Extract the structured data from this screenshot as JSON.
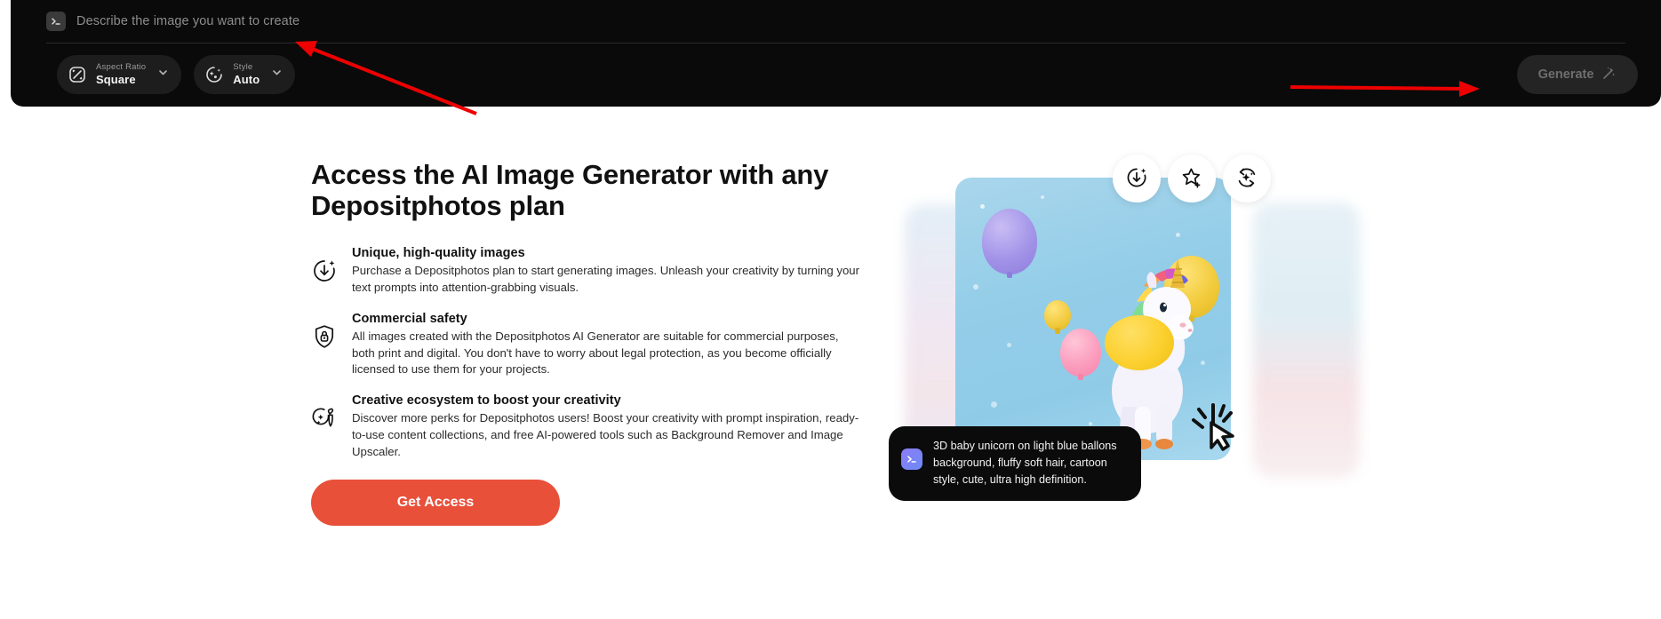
{
  "generator": {
    "prompt_icon": "terminal-icon",
    "prompt_placeholder": "Describe the image you want to create",
    "prompt_value": "",
    "controls": [
      {
        "icon": "aspect-ratio-icon",
        "label": "Aspect Ratio",
        "value": "Square"
      },
      {
        "icon": "style-sparkle-icon",
        "label": "Style",
        "value": "Auto"
      }
    ],
    "generate_label": "Generate",
    "generate_icon": "magic-wand-icon"
  },
  "promo": {
    "headline": "Access the AI Image Generator with any Depositphotos plan",
    "features": [
      {
        "icon": "download-sparkle-icon",
        "title": "Unique, high-quality images",
        "desc": "Purchase a Depositphotos plan to start generating images. Unleash your creativity by turning your text prompts into attention-grabbing visuals."
      },
      {
        "icon": "shield-lock-icon",
        "title": "Commercial safety",
        "desc": "All images created with the Depositphotos AI Generator are suitable for commercial purposes, both print and digital. You don't have to worry about legal protection, as you become officially licensed to use them for your projects."
      },
      {
        "icon": "magic-wand-sparkle-icon",
        "title": "Creative ecosystem to boost your creativity",
        "desc": "Discover more perks for Depositphotos users! Boost your creativity with prompt inspiration, ready-to-use content collections, and free AI-powered tools such as Background Remover and Image Upscaler."
      }
    ],
    "cta_label": "Get Access"
  },
  "showcase": {
    "image_alt": "3D baby unicorn with balloons",
    "actions": [
      {
        "icon": "download-sparkle-icon",
        "name": "download-button"
      },
      {
        "icon": "star-plus-icon",
        "name": "favorite-button"
      },
      {
        "icon": "regenerate-sparkle-icon",
        "name": "regenerate-button"
      }
    ],
    "bubble_icon": "terminal-icon",
    "bubble_prompt": "3D baby unicorn on light blue ballons background, fluffy soft hair, cartoon style, cute, ultra high definition."
  },
  "annotations": {
    "arrow_1": "points-to-prompt-input",
    "arrow_2": "points-to-generate-button",
    "color": "#ee0000"
  },
  "colors": {
    "panel_bg": "#0a0a0a",
    "cta_red": "#e8503a",
    "generate_bg": "#242424",
    "annotation_red": "#ee0000"
  }
}
